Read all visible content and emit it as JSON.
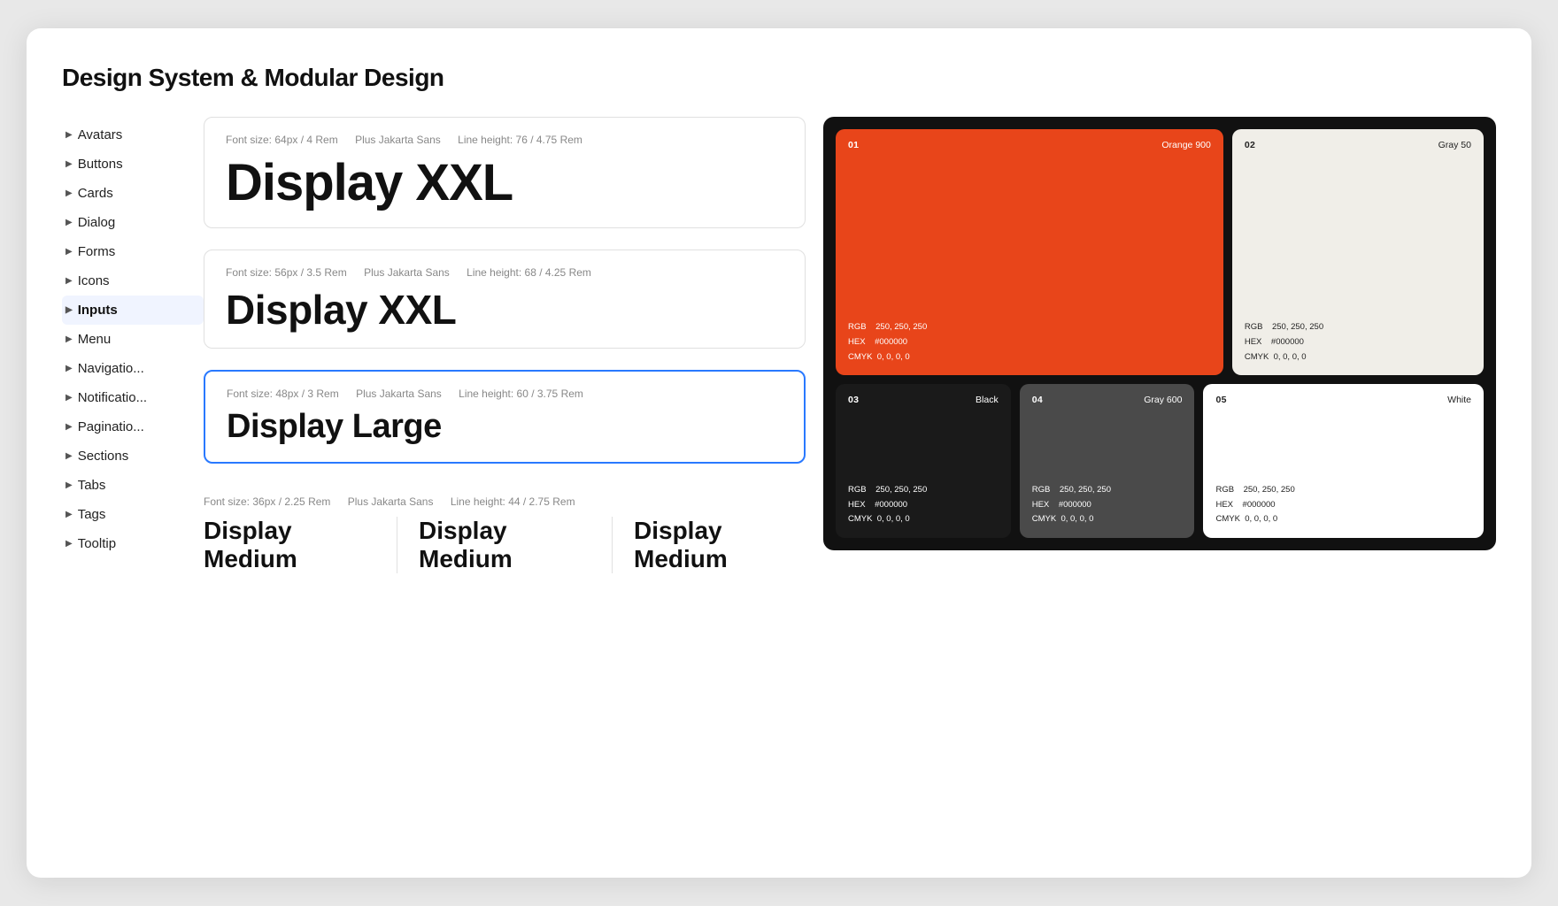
{
  "page": {
    "title": "Design System & Modular Design"
  },
  "sidebar": {
    "items": [
      {
        "label": "Avatars",
        "active": false
      },
      {
        "label": "Buttons",
        "active": false
      },
      {
        "label": "Cards",
        "active": false
      },
      {
        "label": "Dialog",
        "active": false
      },
      {
        "label": "Forms",
        "active": false
      },
      {
        "label": "Icons",
        "active": false
      },
      {
        "label": "Inputs",
        "active": true
      },
      {
        "label": "Menu",
        "active": false
      },
      {
        "label": "Navigation",
        "active": false
      },
      {
        "label": "Notifications",
        "active": false
      },
      {
        "label": "Pagination",
        "active": false
      },
      {
        "label": "Sections",
        "active": false
      },
      {
        "label": "Tabs",
        "active": false
      },
      {
        "label": "Tags",
        "active": false
      },
      {
        "label": "Tooltip",
        "active": false
      }
    ]
  },
  "typography": {
    "panel1": {
      "meta_size": "Font size: 64px / 4 Rem",
      "meta_font": "Plus Jakarta Sans",
      "meta_lh": "Line height: 76 / 4.75 Rem",
      "display": "Display XXL"
    },
    "panel2": {
      "meta_size": "Font size: 56px / 3.5 Rem",
      "meta_font": "Plus Jakarta Sans",
      "meta_lh": "Line height: 68 / 4.25 Rem",
      "display": "Display XXL"
    },
    "panel3": {
      "meta_size": "Font size: 48px / 3 Rem",
      "meta_font": "Plus Jakarta Sans",
      "meta_lh": "Line height: 60 / 3.75 Rem",
      "display": "Display Large"
    },
    "panel4": {
      "meta_size": "Font size: 36px / 2.25 Rem",
      "meta_font": "Plus Jakarta Sans",
      "meta_lh": "Line height: 44 / 2.75 Rem",
      "display1": "Display Medium",
      "display2": "Display Medium",
      "display3": "Display Medium"
    }
  },
  "palette": {
    "cards": [
      {
        "num": "01",
        "name": "Orange 900",
        "bg": "#E8451A",
        "textColor": "white",
        "rgb": "250, 250, 250",
        "hex": "#000000",
        "cmyk": "0, 0, 0, 0"
      },
      {
        "num": "02",
        "name": "Gray 50",
        "bg": "#F0EEE8",
        "textColor": "dark",
        "rgb": "250, 250, 250",
        "hex": "#000000",
        "cmyk": "0, 0, 0, 0"
      },
      {
        "num": "03",
        "name": "Black",
        "bg": "#1a1a1a",
        "textColor": "white",
        "rgb": "250, 250, 250",
        "hex": "#000000",
        "cmyk": "0, 0, 0, 0"
      },
      {
        "num": "04",
        "name": "Gray 600",
        "bg": "#4a4a4a",
        "textColor": "white",
        "rgb": "250, 250, 250",
        "hex": "#000000",
        "cmyk": "0, 0, 0, 0"
      },
      {
        "num": "05",
        "name": "White",
        "bg": "#ffffff",
        "textColor": "dark",
        "rgb": "250, 250, 250",
        "hex": "#000000",
        "cmyk": "0, 0, 0, 0"
      }
    ]
  }
}
